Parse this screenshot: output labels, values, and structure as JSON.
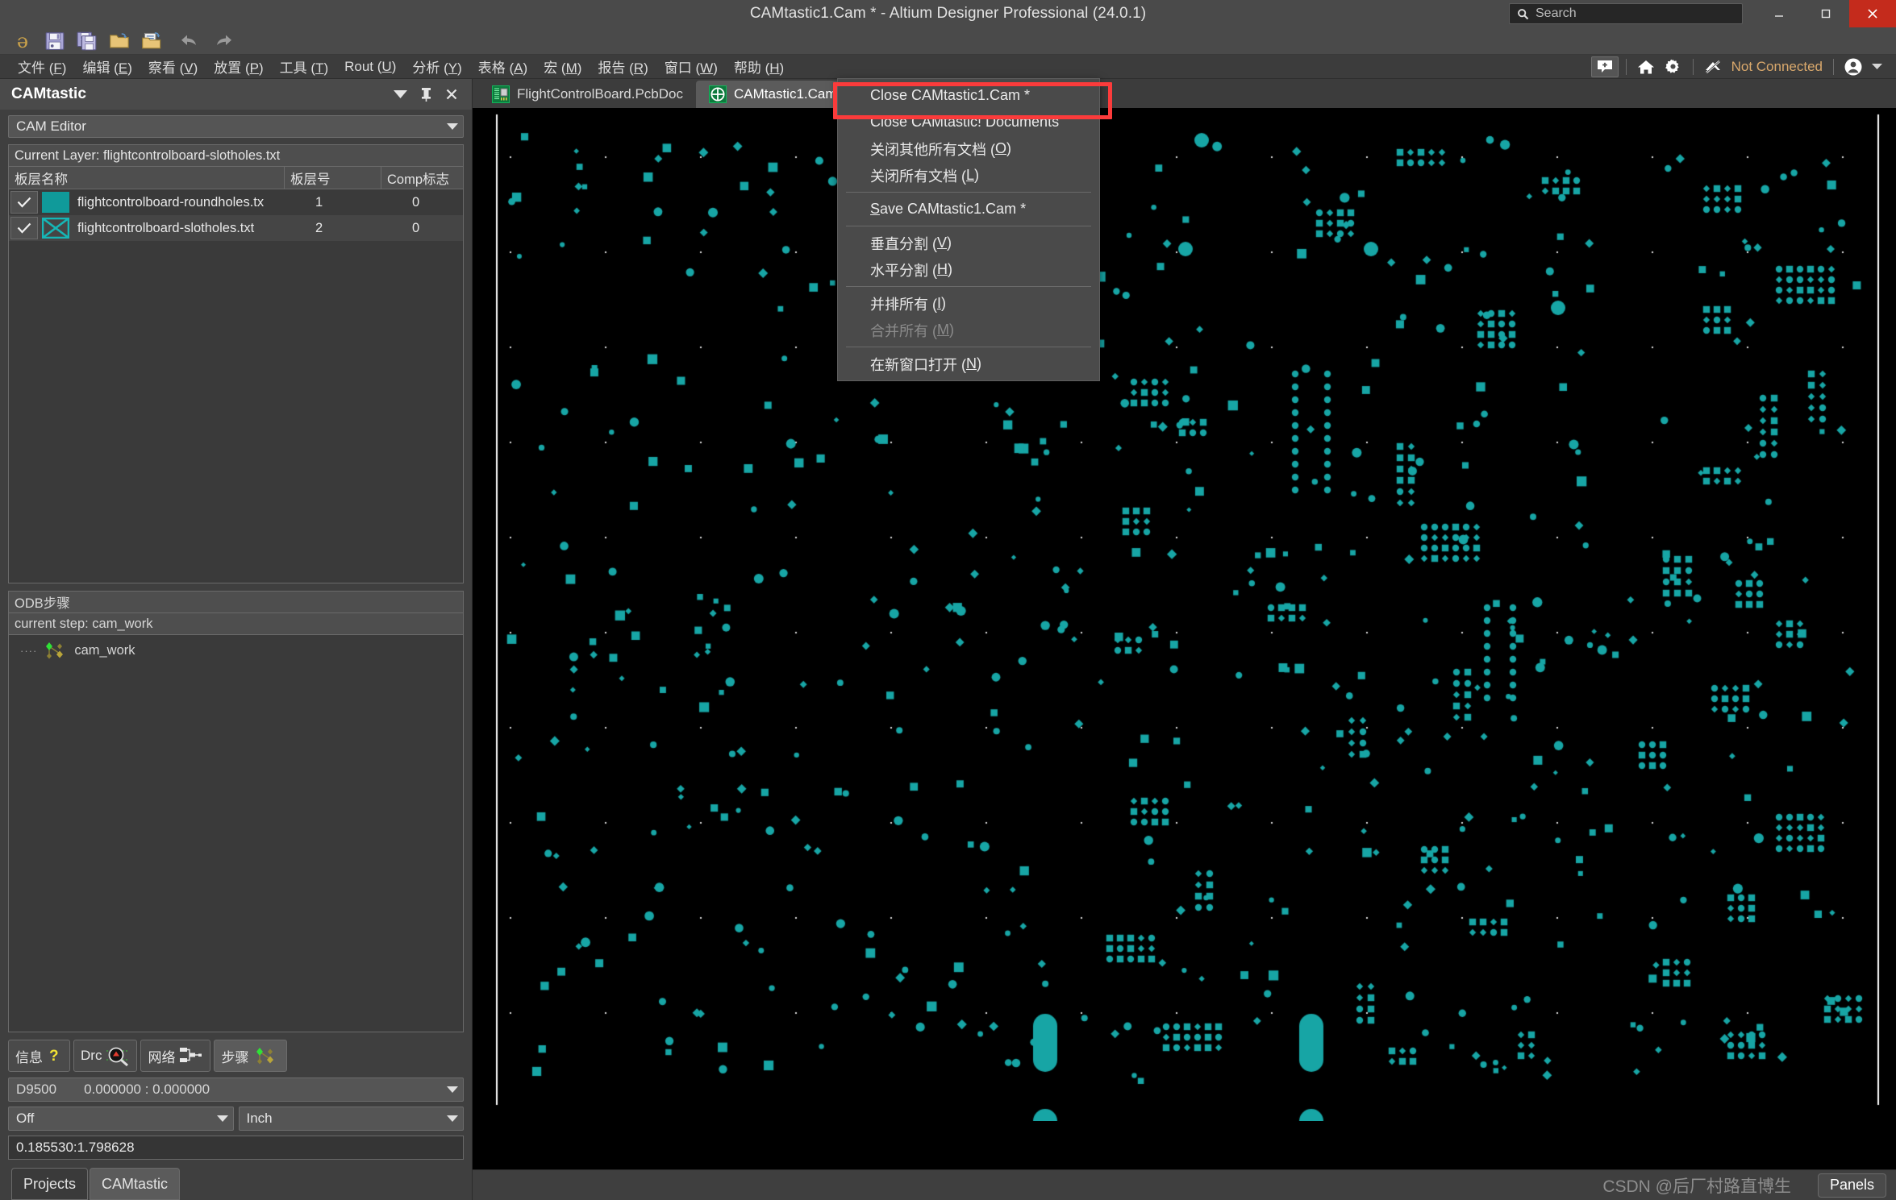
{
  "window": {
    "title": "CAMtastic1.Cam * - Altium Designer Professional (24.0.1)",
    "minimize_label": "–",
    "maximize_label": "□",
    "close_label": "✕"
  },
  "search": {
    "placeholder": "Search",
    "value": "",
    "icon": "search-icon"
  },
  "toolbar": {
    "icons": [
      {
        "name": "altium-logo-icon",
        "glyph": "ə"
      },
      {
        "name": "save-icon"
      },
      {
        "name": "save-all-icon"
      },
      {
        "name": "open-folder-icon"
      },
      {
        "name": "open-document-icon"
      },
      {
        "name": "undo-icon"
      },
      {
        "name": "redo-icon"
      }
    ]
  },
  "menubar": {
    "items": [
      {
        "label": "文件 (F)",
        "key": "F"
      },
      {
        "label": "编辑 (E)",
        "key": "E"
      },
      {
        "label": "察看 (V)",
        "key": "V"
      },
      {
        "label": "放置 (P)",
        "key": "P"
      },
      {
        "label": "工具 (T)",
        "key": "T"
      },
      {
        "label": "Rout (U)",
        "key": "U"
      },
      {
        "label": "分析 (Y)",
        "key": "Y"
      },
      {
        "label": "表格 (A)",
        "key": "A"
      },
      {
        "label": "宏 (M)",
        "key": "M"
      },
      {
        "label": "报告 (R)",
        "key": "R"
      },
      {
        "label": "窗口 (W)",
        "key": "W"
      },
      {
        "label": "帮助 (H)",
        "key": "H"
      }
    ],
    "right": {
      "add_panel_icon": "add-comment-icon",
      "home_icon": "home-icon",
      "settings_icon": "gear-icon",
      "connection_icon": "not-connected-icon",
      "connection_label": "Not Connected",
      "account_icon": "account-icon",
      "dropdown_icon": "chevron-down-icon"
    }
  },
  "panel": {
    "title": "CAMtastic",
    "actions": [
      "dropdown-icon",
      "pin-icon",
      "close-icon"
    ],
    "editor_select": {
      "value": "CAM Editor"
    },
    "current_layer_label": "Current Layer: flightcontrolboard-slotholes.txt",
    "table": {
      "headers": [
        "板层名称",
        "板层号",
        "Comp标志"
      ],
      "rows": [
        {
          "checked": true,
          "color": "#109a9a",
          "swatch_style": "solid",
          "name": "flightcontrolboard-roundholes.tx",
          "layer_no": "1",
          "comp": "0"
        },
        {
          "checked": true,
          "color": "#16b6b6",
          "swatch_style": "cross",
          "name": "flightcontrolboard-slotholes.txt",
          "layer_no": "2",
          "comp": "0"
        }
      ]
    },
    "odb": {
      "header": "ODB步骤",
      "current_step": "current step: cam_work",
      "tree_item": "cam_work"
    },
    "tabs": [
      {
        "label": "信息",
        "icon": "question-mark-icon",
        "active": false
      },
      {
        "label": "Drc",
        "icon": "drc-magnifier-icon",
        "active": false
      },
      {
        "label": "网络",
        "icon": "net-icon",
        "active": false
      },
      {
        "label": "步骤",
        "icon": "steps-icon",
        "active": true
      }
    ],
    "dcode": {
      "code": "D9500",
      "coords": "0.000000 : 0.000000"
    },
    "snap_select": {
      "value": "Off"
    },
    "unit_select": {
      "value": "Inch"
    },
    "coordinate_readout": "0.185530:1.798628",
    "bottom_tabs": [
      {
        "label": "Projects",
        "active": false
      },
      {
        "label": "CAMtastic",
        "active": true
      }
    ]
  },
  "documents": {
    "tabs": [
      {
        "label": "FlightControlBoard.PcbDoc",
        "icon": "pcb-doc-icon",
        "active": false
      },
      {
        "label": "CAMtastic1.Cam *",
        "icon": "cam-doc-icon",
        "active": true
      }
    ]
  },
  "context_menu": {
    "items": [
      {
        "label": "Close CAMtastic1.Cam *",
        "highlighted": true,
        "disabled": false
      },
      {
        "label": "Close CAMtastic! Documents",
        "disabled": false
      },
      {
        "label": "关闭其他所有文档 (O)",
        "disabled": false
      },
      {
        "label": "关闭所有文档 (L)",
        "disabled": false
      },
      {
        "separator": true
      },
      {
        "label": "Save CAMtastic1.Cam *",
        "disabled": false
      },
      {
        "separator": true
      },
      {
        "label": "垂直分割 (V)",
        "disabled": false
      },
      {
        "label": "水平分割 (H)",
        "disabled": false
      },
      {
        "separator": true
      },
      {
        "label": "并排所有 (I)",
        "disabled": false
      },
      {
        "label": "合并所有 (M)",
        "disabled": true
      },
      {
        "separator": true
      },
      {
        "label": "在新窗口打开 (N)",
        "disabled": false
      }
    ],
    "highlight_color": "#fb3b3b"
  },
  "statusbar": {
    "watermark": "CSDN @后厂村路直博生",
    "panels_button": "Panels"
  },
  "canvas": {
    "background": "#000000",
    "drill_color": "#17a5a5",
    "grid_dot_color": "#dcdcdc",
    "board_edge_color": "#ffffff"
  }
}
